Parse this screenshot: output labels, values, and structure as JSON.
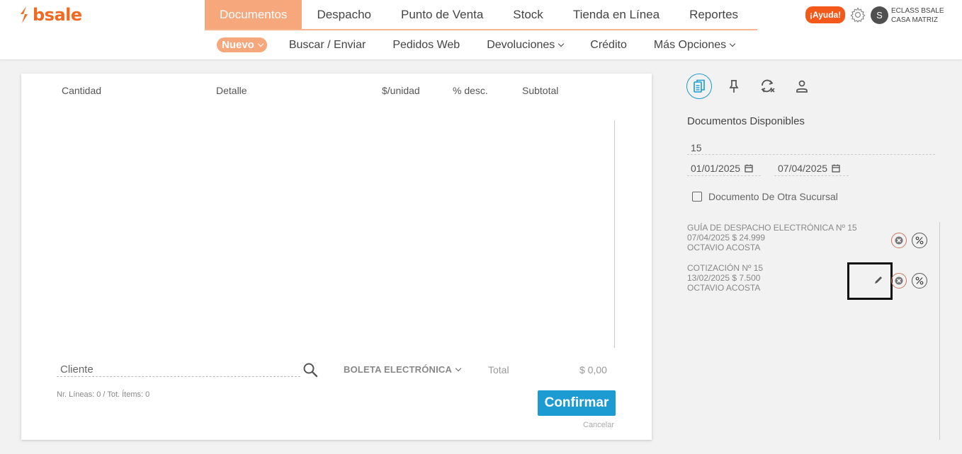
{
  "brand": {
    "name": "bsale",
    "color": "#f26a21"
  },
  "main_nav": {
    "items": [
      "Documentos",
      "Despacho",
      "Punto de Venta",
      "Stock",
      "Tienda en Línea",
      "Reportes"
    ],
    "active_index": 0
  },
  "header": {
    "help_label": "¡Ayuda!",
    "settings_icon": "gear-icon",
    "avatar_initial": "S",
    "company_line1": "ECLASS BSALE",
    "company_line2": "CASA MATRIZ"
  },
  "sub_nav": {
    "nuevo": "Nuevo",
    "buscar": "Buscar / Enviar",
    "pedidos": "Pedidos Web",
    "devoluciones": "Devoluciones",
    "credito": "Crédito",
    "mas": "Más Opciones"
  },
  "table": {
    "headers": {
      "cantidad": "Cantidad",
      "detalle": "Detalle",
      "unidad": "$/unidad",
      "desc": "% desc.",
      "subtotal": "Subtotal"
    }
  },
  "footer": {
    "cliente_placeholder": "Cliente",
    "doc_type": "BOLETA ELECTRÓNICA",
    "total_label": "Total",
    "total_value": "$ 0,00",
    "lines_info": "Nr. Líneas: 0 / Tot. Ítems: 0",
    "confirm_label": "Confirmar",
    "cancel_label": "Cancelar"
  },
  "panel": {
    "tabs": [
      "documents-icon",
      "pin-icon",
      "sync-icon",
      "user-icon"
    ],
    "title": "Documentos Disponibles",
    "doc_number": "15",
    "date_from": "01/01/2025",
    "date_to": "07/04/2025",
    "other_branch_label": "Documento De Otra Sucursal",
    "documents": [
      {
        "title": "GUÍA DE DESPACHO ELECTRÓNICA Nº 15",
        "meta": "07/04/2025 $ 24.999",
        "client": "OCTAVIO ACOSTA"
      },
      {
        "title": "COTIZACIÓN Nº 15",
        "meta": "13/02/2025 $ 7.500",
        "client": "OCTAVIO ACOSTA"
      }
    ]
  },
  "colors": {
    "accent": "#f6a77c",
    "primary": "#1b9bd1",
    "help": "#f2591b"
  }
}
